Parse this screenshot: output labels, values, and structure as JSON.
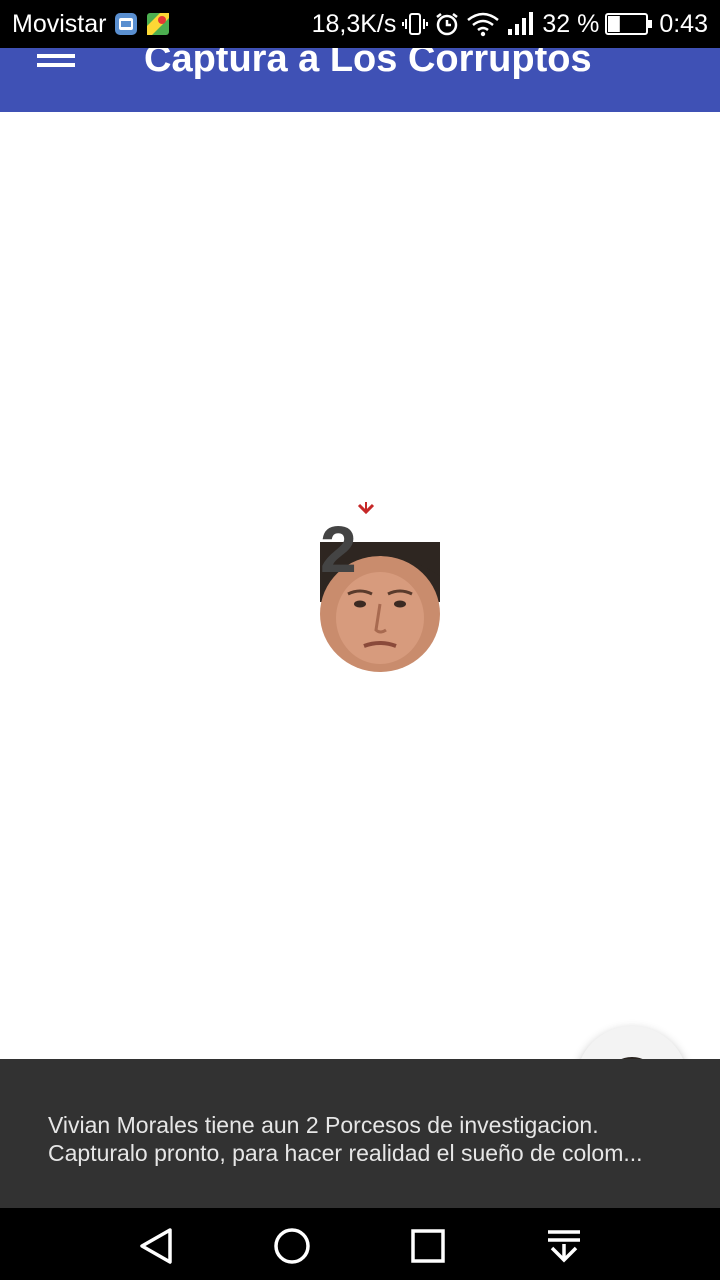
{
  "status_bar": {
    "carrier": "Movistar",
    "network_speed": "18,3K/s",
    "battery_percent": "32 %",
    "battery_level": 0.32,
    "time": "0:43",
    "icons": [
      "app-notification-icon",
      "maps-icon",
      "vibrate-icon",
      "alarm-icon",
      "wifi-icon",
      "signal-icon",
      "battery-icon"
    ]
  },
  "app_bar": {
    "title": "Captura a Los Corruptos",
    "menu_icon": "hamburger-menu-icon",
    "color": "#3F51B5"
  },
  "game": {
    "target_count": "2",
    "marker_icon": "chevron-down-icon",
    "target_image": "politician-face"
  },
  "fab": {
    "image": "player-face-avatar"
  },
  "snackbar": {
    "line1": "Vivian Morales tiene aun 2 Porcesos de investigacion.",
    "line2": "Capturalo pronto, para hacer realidad el sueño de colom..."
  },
  "nav_bar": {
    "buttons": [
      "back-icon",
      "home-icon",
      "recents-icon",
      "notifications-pulldown-icon"
    ]
  }
}
